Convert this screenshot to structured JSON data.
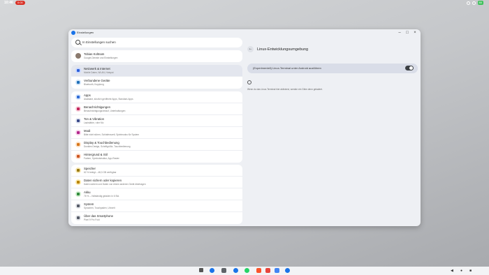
{
  "status_bar": {
    "time": "10:46",
    "recording": "0:00",
    "battery": "80"
  },
  "window": {
    "title": "Einstellungen"
  },
  "search": {
    "placeholder": "In Einstellungen suchen"
  },
  "account": {
    "title": "Tobias Koltnam",
    "subtitle": "Google-Dienste und Einstellungen"
  },
  "group1": [
    {
      "title": "Netzwerk & Internet",
      "subtitle": "Mobile Daten, WLAN, Hotspot",
      "icon": "wifi-icon",
      "color": "#c9d7ff",
      "glyph": "#2b5fd9",
      "selected": true
    },
    {
      "title": "Verbundene Geräte",
      "subtitle": "Bluetooth, Kopplung",
      "icon": "devices-icon",
      "color": "#cfe3f7",
      "glyph": "#1f6fb8",
      "selected": false
    }
  ],
  "group2": [
    {
      "title": "Apps",
      "subtitle": "Assistant, kürzlich geöffnete Apps, Standard-Apps",
      "icon": "apps-icon",
      "color": "#d4e4fb",
      "glyph": "#2d6ad6"
    },
    {
      "title": "Benachrichtigungen",
      "subtitle": "Benachrichtigungsverlauf, Unterhaltungen",
      "icon": "bell-icon",
      "color": "#f8d0dc",
      "glyph": "#c3255c"
    },
    {
      "title": "Ton & Vibration",
      "subtitle": "Lautstärke, ruhe Mo",
      "icon": "sound-icon",
      "color": "#dfe3f0",
      "glyph": "#3a4a8a"
    },
    {
      "title": "Modi",
      "subtitle": "Bitte nicht stören, Schlafenszeit, Spielmodus für System",
      "icon": "modes-icon",
      "color": "#f5cfe9",
      "glyph": "#b2268c"
    },
    {
      "title": "Display & Touchbedienung",
      "subtitle": "Dunkles Design, Schriftgröße, Touchbedienung",
      "icon": "display-icon",
      "color": "#fde0c4",
      "glyph": "#d6761a"
    },
    {
      "title": "Hintergrund & Stil",
      "subtitle": "Farben, Symbolstruktur, App-Raster",
      "icon": "palette-icon",
      "color": "#fcd9c8",
      "glyph": "#cc5520"
    }
  ],
  "group3": [
    {
      "title": "Speicher",
      "subtitle": "62 % belegt – 48,3 GB verfügbar",
      "icon": "storage-icon",
      "color": "#f7e7b3",
      "glyph": "#9a7a10"
    },
    {
      "title": "Daten sichern oder kopieren",
      "subtitle": "Daten sichern und Daten von einem anderen Gerät übertragen",
      "icon": "backup-icon",
      "color": "#fbe6a8",
      "glyph": "#b88300"
    },
    {
      "title": "Akku",
      "subtitle": "76 % – Vollständig geladen in 6 Std.",
      "icon": "battery-icon",
      "color": "#cdeccd",
      "glyph": "#2f8a3b"
    },
    {
      "title": "System",
      "subtitle": "Sprachen, Touchpaden, Uhrzeit",
      "icon": "system-icon",
      "color": "#e3e5ea",
      "glyph": "#555a66"
    },
    {
      "title": "Über das Smartphone",
      "subtitle": "Pixel 9 Pro Fold",
      "icon": "info-icon",
      "color": "#e3e5ea",
      "glyph": "#555a66"
    }
  ],
  "detail": {
    "title": "Linux-Entwicklungsumgebung",
    "toggle_label": "(Experimentell) Linux-Terminal unter Android ausführen",
    "toggle_on": true,
    "info_text": "Wenn du das Linux-Terminal hier aktivierst, werden ein Gbim denn geladeet."
  }
}
